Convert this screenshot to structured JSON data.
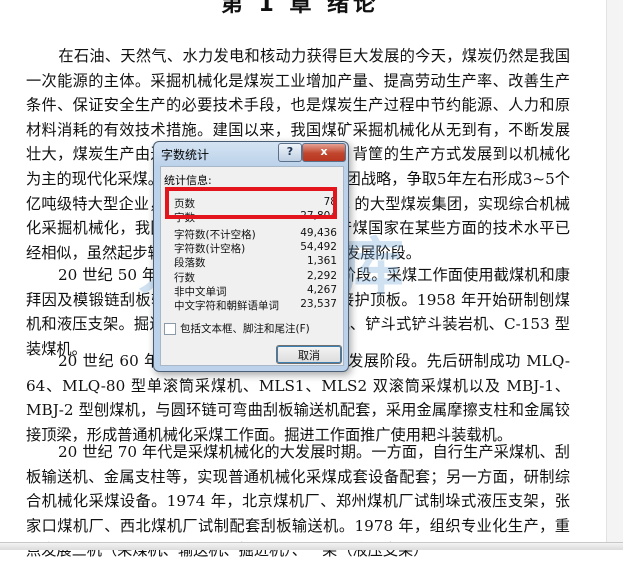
{
  "document": {
    "chapter_title": "第 1 章 绪论",
    "paragraphs": [
      "在石油、天然气、水力发电和核动力获得巨大发展的今天，煤炭仍然是我国一次能源的主体。采掘机械化是煤炭工业增加产量、提高劳动生产率、改善生产条件、保证安全生产的必要技术手段，也是煤炭生产过程中节约能源、人力和原材料消耗的有效技术措施。建国以来，我国煤矿采掘机械化从无到有，不断发展壮大，煤炭生产由过去的手镐落煤和人力拉运、背筐的生产方式发展到以机械化为主的现代化采煤。国家正在实施大公司、大集团战略，争取5年左右形成3~5个亿吨级特大型企业，5~6个年产规模 5000 万 t 的大型煤炭集团，实现综合机械化采掘机械化，我国采掘机械化与世界各主要产煤国家在某些方面的技术水平已经相似，虽然起步较晚，但也经历了几个重要的发展阶段。",
      "20 世纪 50 年代是我国采煤机械化的开始阶段。采煤工作面使用截煤机和康拜因及模锻链刮板输送机、金属摩擦支柱和铰接护顶板。1958 年开始研制刨煤机和液压支架。掘进工作面推广应用耙斗装岩机、铲斗式铲斗装岩机、C-153 型装煤机。",
      "20 世纪 60 年代是我国采煤机械化的初步发展阶段。先后研制成功 MLQ-64、MLQ-80 型单滚筒采煤机、MLS1、MLS2 双滚筒采煤机以及 MBJ-1、MBJ-2 型刨煤机，与圆环链可弯曲刮板输送机配套，采用金属摩擦支柱和金属铰接顶梁，形成普通机械化采煤工作面。掘进工作面推广使用耙斗装载机。",
      "20 世纪 70 年代是采煤机械化的大发展时期。一方面，自行生产采煤机、刮板输送机、金属支柱等，实现普通机械化采煤成套设备配套；另一方面，研制综合机械化采煤设备。1974 年，北京煤机厂、郑州煤机厂试制垛式液压支架，张家口煤机厂、西北煤机厂试制配套刮板输送机。1978 年，组织专业化生产，重点发展三机（采煤机、输送机、掘进机）、一架（液压支架）"
    ]
  },
  "watermark": {
    "text": "人人文库",
    "subtext": "www.renrendoc.com"
  },
  "dialog": {
    "title": "字数统计",
    "help_label": "?",
    "close_label": "x",
    "stats_header": "统计信息:",
    "stats": [
      {
        "label": "页数",
        "value": "78"
      },
      {
        "label": "字数",
        "value": "27,804"
      },
      {
        "label": "字符数(不计空格)",
        "value": "49,436"
      },
      {
        "label": "字符数(计空格)",
        "value": "54,492"
      },
      {
        "label": "段落数",
        "value": "1,361"
      },
      {
        "label": "行数",
        "value": "2,292"
      },
      {
        "label": "非中文单词",
        "value": "4,267"
      },
      {
        "label": "中文字符和朝鲜语单词",
        "value": "23,537"
      }
    ],
    "checkbox_label": "包括文本框、脚注和尾注(F)",
    "checkbox_checked": false,
    "cancel_label": "取消",
    "highlight_color": "#e4141c"
  }
}
